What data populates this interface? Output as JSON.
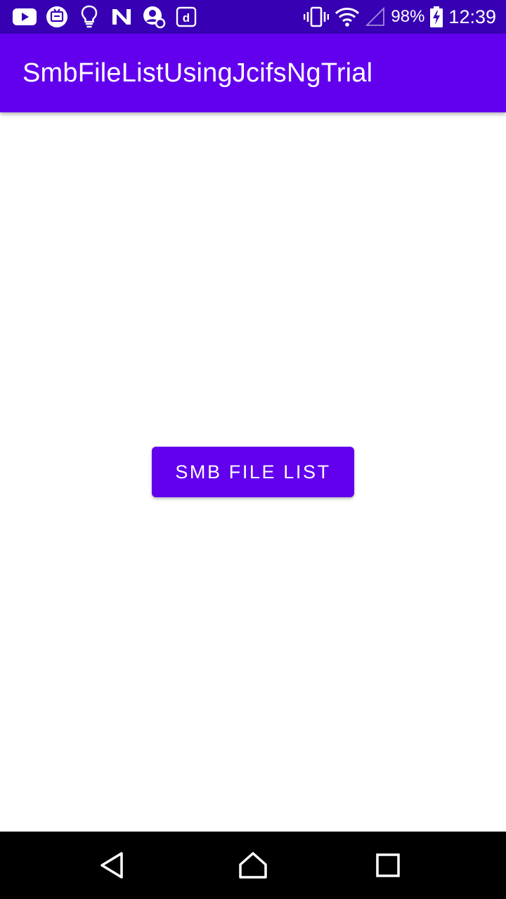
{
  "status_bar": {
    "left_icons": [
      "youtube-icon",
      "tv-app-icon",
      "lightbulb-icon",
      "n-app-icon",
      "account-settings-icon",
      "d-app-icon"
    ],
    "battery_percent": "98%",
    "time": "12:39",
    "colors": {
      "background": "#3700b3"
    }
  },
  "app_bar": {
    "title": "SmbFileListUsingJcifsNgTrial",
    "colors": {
      "background": "#6200ee"
    }
  },
  "main": {
    "smb_button_label": "SMB FILE LIST",
    "colors": {
      "button_background": "#6200ee",
      "button_text": "#ffffff"
    }
  },
  "nav_bar": {
    "buttons": [
      "back-icon",
      "home-icon",
      "recents-icon"
    ]
  }
}
